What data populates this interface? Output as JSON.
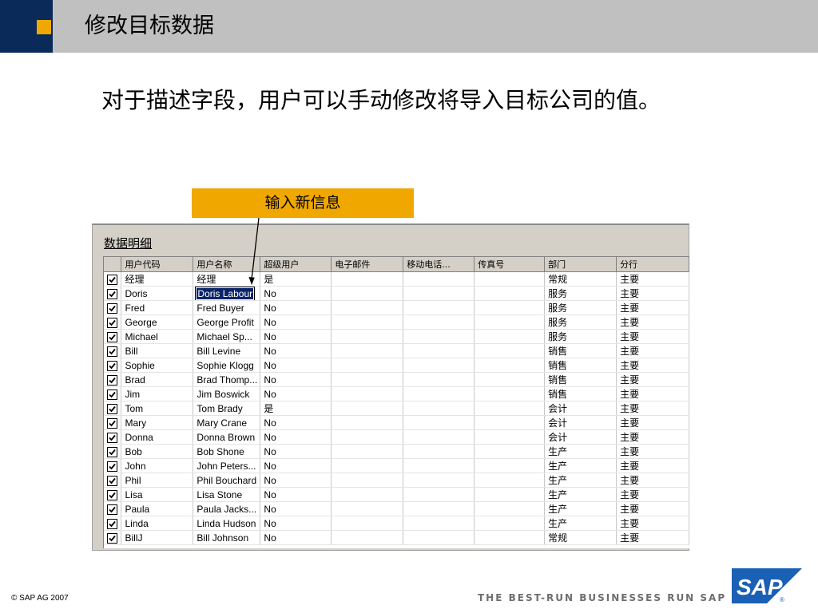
{
  "slide": {
    "title": "修改目标数据",
    "body_text": "对于描述字段，用户可以手动修改将导入目标公司的值。",
    "callout_label": "输入新信息"
  },
  "panel": {
    "title": "数据明细",
    "columns": [
      "用户代码",
      "用户名称",
      "超级用户",
      "电子邮件",
      "移动电话...",
      "传真号",
      "部门",
      "分行"
    ],
    "rows": [
      [
        "经理",
        "经理",
        "是",
        "",
        "",
        "",
        "常规",
        "主要"
      ],
      [
        "Doris",
        "Doris Labour",
        "No",
        "",
        "",
        "",
        "服务",
        "主要"
      ],
      [
        "Fred",
        "Fred Buyer",
        "No",
        "",
        "",
        "",
        "服务",
        "主要"
      ],
      [
        "George",
        "George Profit",
        "No",
        "",
        "",
        "",
        "服务",
        "主要"
      ],
      [
        "Michael",
        "Michael Sp...",
        "No",
        "",
        "",
        "",
        "服务",
        "主要"
      ],
      [
        "Bill",
        "Bill Levine",
        "No",
        "",
        "",
        "",
        "销售",
        "主要"
      ],
      [
        "Sophie",
        "Sophie Klogg",
        "No",
        "",
        "",
        "",
        "销售",
        "主要"
      ],
      [
        "Brad",
        "Brad Thomp...",
        "No",
        "",
        "",
        "",
        "销售",
        "主要"
      ],
      [
        "Jim",
        "Jim Boswick",
        "No",
        "",
        "",
        "",
        "销售",
        "主要"
      ],
      [
        "Tom",
        "Tom Brady",
        "是",
        "",
        "",
        "",
        "会计",
        "主要"
      ],
      [
        "Mary",
        "Mary Crane",
        "No",
        "",
        "",
        "",
        "会计",
        "主要"
      ],
      [
        "Donna",
        "Donna Brown",
        "No",
        "",
        "",
        "",
        "会计",
        "主要"
      ],
      [
        "Bob",
        "Bob Shone",
        "No",
        "",
        "",
        "",
        "生产",
        "主要"
      ],
      [
        "John",
        "John Peters...",
        "No",
        "",
        "",
        "",
        "生产",
        "主要"
      ],
      [
        "Phil",
        "Phil Bouchard",
        "No",
        "",
        "",
        "",
        "生产",
        "主要"
      ],
      [
        "Lisa",
        "Lisa Stone",
        "No",
        "",
        "",
        "",
        "生产",
        "主要"
      ],
      [
        "Paula",
        "Paula Jacks...",
        "No",
        "",
        "",
        "",
        "生产",
        "主要"
      ],
      [
        "Linda",
        "Linda Hudson",
        "No",
        "",
        "",
        "",
        "生产",
        "主要"
      ],
      [
        "BillJ",
        "Bill Johnson",
        "No",
        "",
        "",
        "",
        "常规",
        "主要"
      ]
    ],
    "selected_cell": {
      "row": 1,
      "col": 1
    }
  },
  "footer": {
    "copyright": "©  SAP AG 2007",
    "tagline": "THE BEST-RUN BUSINESSES RUN SAP",
    "logo_text": "SAP"
  },
  "colors": {
    "accent_orange": "#f0a800",
    "navy": "#0a2a5a",
    "title_bar_gray": "#c0c0c0",
    "selection_blue": "#0a246a",
    "logo_blue": "#1a60b4"
  },
  "icons": {
    "checkbox": "checked-checkbox-icon",
    "logo": "sap-logo"
  }
}
